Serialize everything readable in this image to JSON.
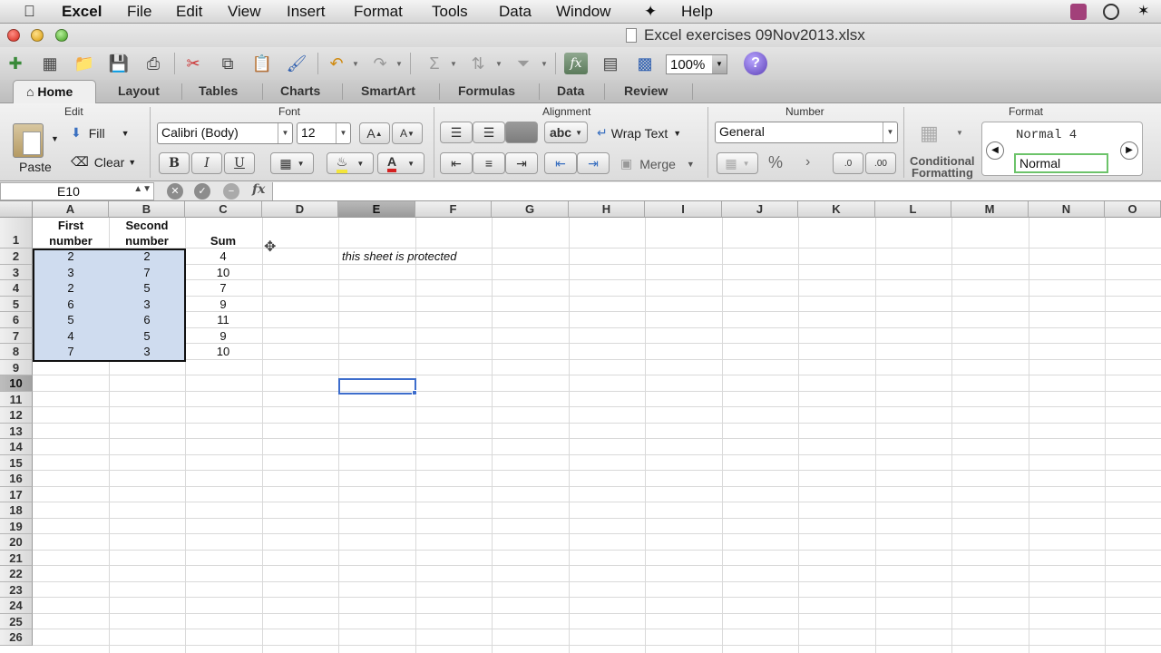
{
  "menubar": {
    "app_name": "Excel",
    "items": [
      "File",
      "Edit",
      "View",
      "Insert",
      "Format",
      "Tools",
      "Data",
      "Window",
      "Help"
    ]
  },
  "window": {
    "title": "Excel exercises 09Nov2013.xlsx"
  },
  "toolbar": {
    "zoom": "100%",
    "help": "?"
  },
  "ribbon": {
    "tabs": [
      "Home",
      "Layout",
      "Tables",
      "Charts",
      "SmartArt",
      "Formulas",
      "Data",
      "Review"
    ],
    "active_tab": "Home",
    "groups": {
      "edit": {
        "title": "Edit",
        "paste": "Paste",
        "fill": "Fill",
        "clear": "Clear"
      },
      "font": {
        "title": "Font",
        "font_name": "Calibri (Body)",
        "font_size": "12",
        "bold": "B",
        "italic": "I",
        "underline": "U",
        "grow": "A",
        "shrink": "A",
        "text_color": "A"
      },
      "alignment": {
        "title": "Alignment",
        "orientation": "abc",
        "wrap_text": "Wrap Text",
        "merge": "Merge"
      },
      "number": {
        "title": "Number",
        "format": "General",
        "percent": "%",
        "comma": "›",
        "increase_decimal": ".0",
        "decrease_decimal": ".00"
      },
      "format": {
        "title": "Format",
        "conditional_formatting_line1": "Conditional",
        "conditional_formatting_line2": "Formatting",
        "style_1": "Normal 4",
        "style_2": "Normal"
      }
    }
  },
  "formula_bar": {
    "name_box": "E10",
    "fx": "fx",
    "formula": ""
  },
  "sheet": {
    "columns": [
      "A",
      "B",
      "C",
      "D",
      "E",
      "F",
      "G",
      "H",
      "I",
      "J",
      "K",
      "L",
      "M",
      "N",
      "O"
    ],
    "selected_column": "E",
    "selected_row": "10",
    "rows": [
      "1",
      "2",
      "3",
      "4",
      "5",
      "6",
      "7",
      "8",
      "9",
      "10",
      "11",
      "12",
      "13",
      "14",
      "15",
      "16",
      "17",
      "18",
      "19",
      "20",
      "21",
      "22",
      "23",
      "24",
      "25",
      "26"
    ],
    "header": {
      "a_line1": "First",
      "a_line2": "number",
      "b_line1": "Second",
      "b_line2": "number",
      "c": "Sum"
    },
    "data": [
      [
        "2",
        "2",
        "4"
      ],
      [
        "3",
        "7",
        "10"
      ],
      [
        "2",
        "5",
        "7"
      ],
      [
        "6",
        "3",
        "9"
      ],
      [
        "5",
        "6",
        "11"
      ],
      [
        "4",
        "5",
        "9"
      ],
      [
        "7",
        "3",
        "10"
      ]
    ],
    "note": "this sheet is protected"
  }
}
